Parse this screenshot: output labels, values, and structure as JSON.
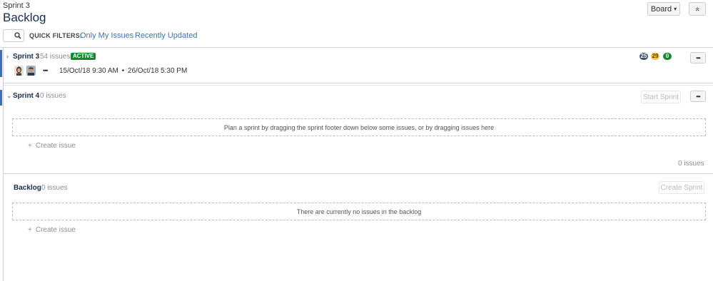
{
  "header": {
    "breadcrumb": "Sprint 3",
    "title": "Backlog",
    "board_button": "Board",
    "board_caret": "▾",
    "collapse_icon": "«"
  },
  "quick_filters": {
    "label": "QUICK FILTERS:",
    "filters": [
      "Only My Issues",
      "Recently Updated"
    ]
  },
  "sprint3": {
    "chevron": "›",
    "name": "Sprint 3",
    "issues": "54 issues",
    "badge": "ACTIVE",
    "more": "•••",
    "dates_start": "15/Oct/18 9:30 AM",
    "dates_sep": "•",
    "dates_end": "26/Oct/18 5:30 PM",
    "counts": {
      "todo": "25",
      "inprogress": "29",
      "done": "0"
    },
    "menu": "•••"
  },
  "sprint4": {
    "chevron": "⌄",
    "name": "Sprint 4",
    "issues": "0 issues",
    "start_button": "Start Sprint",
    "menu": "•••",
    "placeholder": "Plan a sprint by dragging the sprint footer down below some issues, or by dragging issues here",
    "create_plus": "+",
    "create_label": "Create issue",
    "footer_count": "0 issues"
  },
  "backlog": {
    "name": "Backlog",
    "issues": "0 issues",
    "create_sprint_button": "Create Sprint",
    "placeholder": "There are currently no issues in the backlog",
    "create_plus": "+",
    "create_label": "Create issue"
  },
  "colors": {
    "todo": "#42526e",
    "inprogress": "#f6c342",
    "done": "#14892c",
    "link": "#3b73af"
  }
}
